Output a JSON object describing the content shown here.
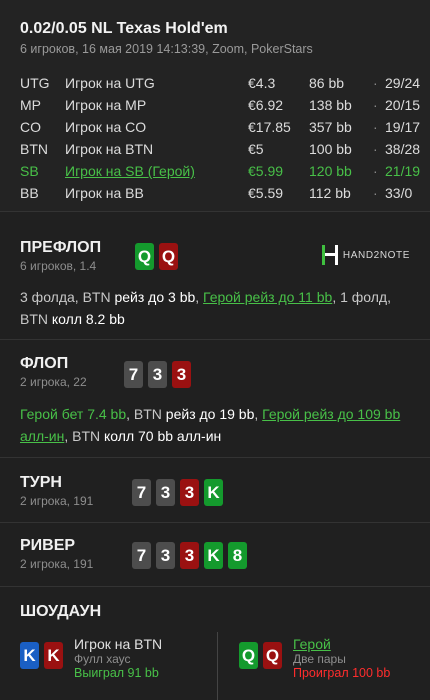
{
  "header": {
    "title": "0.02/0.05 NL Texas Hold'em",
    "subtitle": "6 игроков, 16 мая 2019 14:13:39, Zoom, PokerStars"
  },
  "players": [
    {
      "pos": "UTG",
      "name": "Игрок на UTG",
      "stack": "€4.3",
      "bb": "86 bb",
      "hands": "29/24"
    },
    {
      "pos": "MP",
      "name": "Игрок на MP",
      "stack": "€6.92",
      "bb": "138 bb",
      "hands": "20/15"
    },
    {
      "pos": "CO",
      "name": "Игрок на CO",
      "stack": "€17.85",
      "bb": "357 bb",
      "hands": "19/17"
    },
    {
      "pos": "BTN",
      "name": "Игрок на BTN",
      "stack": "€5",
      "bb": "100 bb",
      "hands": "38/28"
    },
    {
      "pos": "SB",
      "name": "Игрок на SB (Герой)",
      "stack": "€5.99",
      "bb": "120 bb",
      "hands": "21/19",
      "hero": true
    },
    {
      "pos": "BB",
      "name": "Игрок на BB",
      "stack": "€5.59",
      "bb": "112 bb",
      "hands": "33/0"
    }
  ],
  "separator": "·",
  "logo": {
    "text": "HAND2NOTE",
    "icon": "h2n-logo-icon"
  },
  "preflop": {
    "name": "ПРЕФЛОП",
    "sub": "6 игроков, 1.4",
    "cards": [
      {
        "rank": "Q",
        "suit": "green"
      },
      {
        "rank": "Q",
        "suit": "red"
      }
    ],
    "actions": [
      "3 фолда, BTN ",
      "рейз до 3 bb",
      ", ",
      "Герой рейз до 11 bb",
      ", 1 фолд, BTN ",
      "колл 8.2 bb"
    ]
  },
  "flop": {
    "name": "ФЛОП",
    "sub": "2 игрока, 22",
    "cards": [
      {
        "rank": "7",
        "suit": "grey"
      },
      {
        "rank": "3",
        "suit": "grey"
      },
      {
        "rank": "3",
        "suit": "red"
      }
    ],
    "actions": [
      "Герой бет 7.4 bb",
      ", BTN ",
      "рейз до 19 bb",
      ", ",
      "Герой рейз до 109 bb алл-ин",
      ", BTN ",
      "колл 70 bb алл-ин"
    ]
  },
  "turn": {
    "name": "ТУРН",
    "sub": "2 игрока, 191",
    "cards": [
      {
        "rank": "7",
        "suit": "grey"
      },
      {
        "rank": "3",
        "suit": "grey"
      },
      {
        "rank": "3",
        "suit": "red"
      },
      {
        "rank": "K",
        "suit": "green"
      }
    ]
  },
  "river": {
    "name": "РИВЕР",
    "sub": "2 игрока, 191",
    "cards": [
      {
        "rank": "7",
        "suit": "grey"
      },
      {
        "rank": "3",
        "suit": "grey"
      },
      {
        "rank": "3",
        "suit": "red"
      },
      {
        "rank": "K",
        "suit": "green"
      },
      {
        "rank": "8",
        "suit": "green"
      }
    ]
  },
  "showdown": {
    "name": "ШОУДАУН",
    "left": {
      "cards": [
        {
          "rank": "K",
          "suit": "blue"
        },
        {
          "rank": "K",
          "suit": "red"
        }
      ],
      "name": "Игрок на BTN",
      "combo": "Фулл хаус",
      "result": "Выиграл 91 bb"
    },
    "right": {
      "cards": [
        {
          "rank": "Q",
          "suit": "green"
        },
        {
          "rank": "Q",
          "suit": "red"
        }
      ],
      "name": "Герой",
      "combo": "Две пары",
      "result": "Проиграл 100 bb"
    }
  },
  "colors": {
    "accent_green": "#48c048",
    "loss_red": "#ff2d2d",
    "suit_green": "#149a2d",
    "suit_red": "#9a1111",
    "suit_grey": "#4d4d4d",
    "suit_blue": "#1a5fc4"
  }
}
